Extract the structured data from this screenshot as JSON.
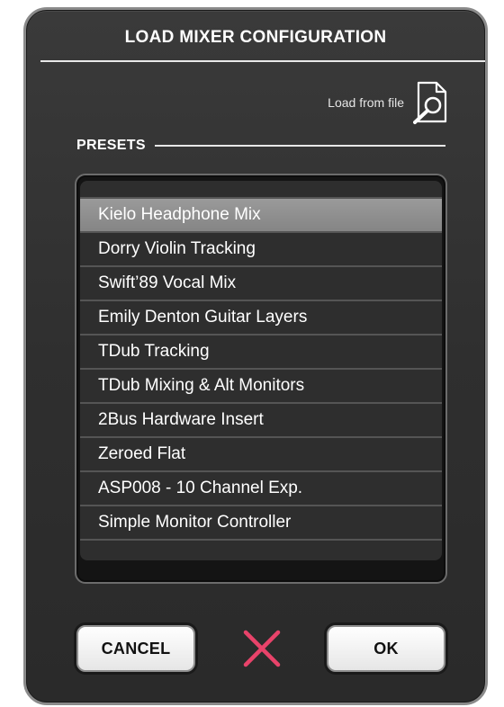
{
  "dialog": {
    "title": "LOAD MIXER CONFIGURATION",
    "load_from_file_label": "Load from file",
    "load_from_file_icon": "file-search-icon",
    "presets_heading": "PRESETS",
    "presets": [
      {
        "label": "Kielo Headphone Mix",
        "selected": true
      },
      {
        "label": "Dorry Violin Tracking",
        "selected": false
      },
      {
        "label": "Swift’89 Vocal Mix",
        "selected": false
      },
      {
        "label": "Emily Denton Guitar Layers",
        "selected": false
      },
      {
        "label": "TDub Tracking",
        "selected": false
      },
      {
        "label": "TDub Mixing & Alt Monitors",
        "selected": false
      },
      {
        "label": "2Bus Hardware Insert",
        "selected": false
      },
      {
        "label": "Zeroed Flat",
        "selected": false
      },
      {
        "label": "ASP008 - 10 Channel Exp.",
        "selected": false
      },
      {
        "label": "Simple Monitor Controller",
        "selected": false
      }
    ],
    "cancel_label": "CANCEL",
    "ok_label": "OK",
    "close_icon": "x-close-icon"
  },
  "colors": {
    "accent_x": "#e8436a",
    "selected_row": "#909090",
    "row_bg": "#2e2e2e"
  }
}
